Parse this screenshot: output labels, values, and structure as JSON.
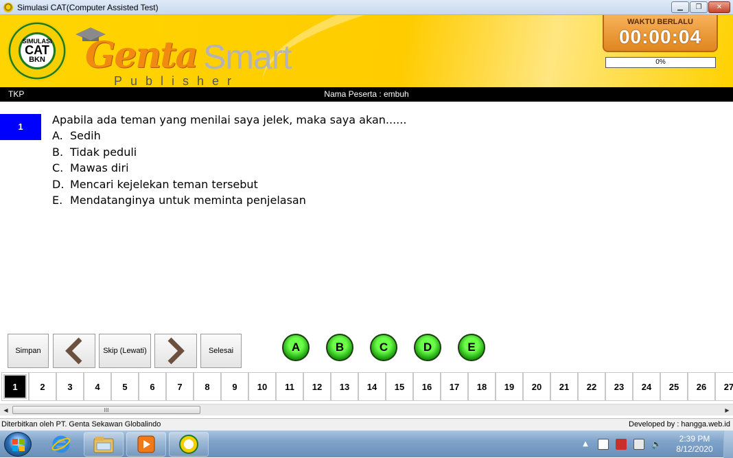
{
  "window": {
    "title": "Simulasi CAT(Computer Assisted Test)",
    "controls": [
      "minimize",
      "maximize",
      "close"
    ]
  },
  "header": {
    "badge": {
      "line1": "SIMULASI",
      "line2": "CAT",
      "line3": "BKN"
    },
    "logo": {
      "genta": "Genta",
      "smart": "Smart",
      "publisher": "Publisher"
    },
    "timer_label": "WAKTU BERLALU",
    "timer_value": "00:00:04",
    "progress_text": "0%",
    "progress_value": 0
  },
  "infobar": {
    "category": "TKP",
    "peserta": "Nama Peserta : embuh"
  },
  "question": {
    "number": "1",
    "text": "Apabila ada teman yang menilai saya jelek, maka saya akan......",
    "options": [
      {
        "letter": "A.",
        "text": "Sedih"
      },
      {
        "letter": "B.",
        "text": "Tidak peduli"
      },
      {
        "letter": "C.",
        "text": "Mawas diri"
      },
      {
        "letter": "D.",
        "text": "Mencari kejelekan teman tersebut"
      },
      {
        "letter": "E.",
        "text": "Mendatanginya untuk meminta penjelasan"
      }
    ]
  },
  "toolbar": {
    "simpan": "Simpan",
    "prev_icon": "chevron-left-icon",
    "skip": "Skip (Lewati)",
    "next_icon": "chevron-right-icon",
    "selesai": "Selesai",
    "answers": [
      "A",
      "B",
      "C",
      "D",
      "E"
    ]
  },
  "question_strip": {
    "numbers": [
      "1",
      "2",
      "3",
      "4",
      "5",
      "6",
      "7",
      "8",
      "9",
      "10",
      "11",
      "12",
      "13",
      "14",
      "15",
      "16",
      "17",
      "18",
      "19",
      "20",
      "21",
      "22",
      "23",
      "24",
      "25",
      "26",
      "27"
    ],
    "active": "1"
  },
  "scrollbar": {
    "thumb_grip": "III"
  },
  "statusbar": {
    "left": "Diterbitkan oleh PT. Genta Sekawan Globalindo",
    "right": "Developed by : hangga.web.id"
  },
  "taskbar": {
    "apps": [
      "internet-explorer-icon",
      "file-explorer-icon",
      "media-player-icon",
      "simulasi-cat-icon"
    ],
    "tray_icons": [
      "show-hidden-icons",
      "action-center-flag-icon",
      "network-warning-icon",
      "power-icon",
      "volume-icon"
    ],
    "time": "2:39 PM",
    "date": "8/12/2020"
  }
}
